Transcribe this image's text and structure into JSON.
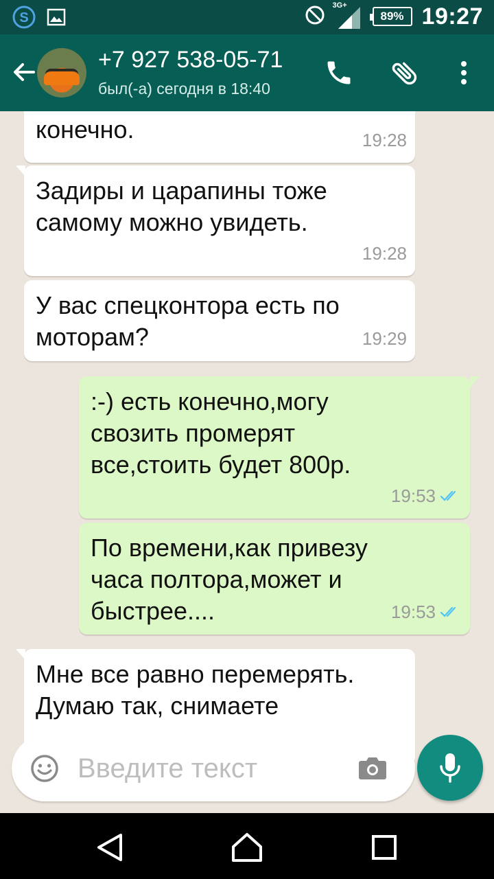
{
  "status_bar": {
    "network": "3G+",
    "battery": "89%",
    "time": "19:27",
    "icons": [
      "skype-icon",
      "gallery-icon",
      "do-not-disturb-icon",
      "signal-icon",
      "battery-icon"
    ]
  },
  "header": {
    "contact_name": "+7 927 538-05-71",
    "last_seen": "был(-а) сегодня в 18:40",
    "actions": [
      "call-icon",
      "attach-icon",
      "more-icon"
    ]
  },
  "messages": [
    {
      "direction": "in",
      "text": "конечно.",
      "time": "19:28"
    },
    {
      "direction": "in",
      "text": "Задиры и царапины тоже\nсамому можно увидеть.",
      "time": "19:28"
    },
    {
      "direction": "in",
      "text": "У вас спецконтора есть по\nмоторам?",
      "time": "19:29"
    },
    {
      "direction": "out",
      "text": ":-) есть конечно,могу\nсвозить промерят\nвсе,стоить будет 800р.",
      "time": "19:53",
      "status": "read"
    },
    {
      "direction": "out",
      "text": "По времени,как привезу\nчаса полтора,может и\nбыстрее....",
      "time": "19:53",
      "status": "read"
    },
    {
      "direction": "in",
      "text": "Мне все равно перемерять.\nДумаю так, снимаете",
      "time": ""
    }
  ],
  "composer": {
    "placeholder": "Введите текст"
  },
  "colors": {
    "status_bar": "#0b4d46",
    "app_bar": "#075e54",
    "chat_background": "#ece5dd",
    "incoming_bubble": "#ffffff",
    "outgoing_bubble": "#dcf8c6",
    "mic_button": "#128c7e",
    "read_ticks": "#4fc3f7"
  }
}
